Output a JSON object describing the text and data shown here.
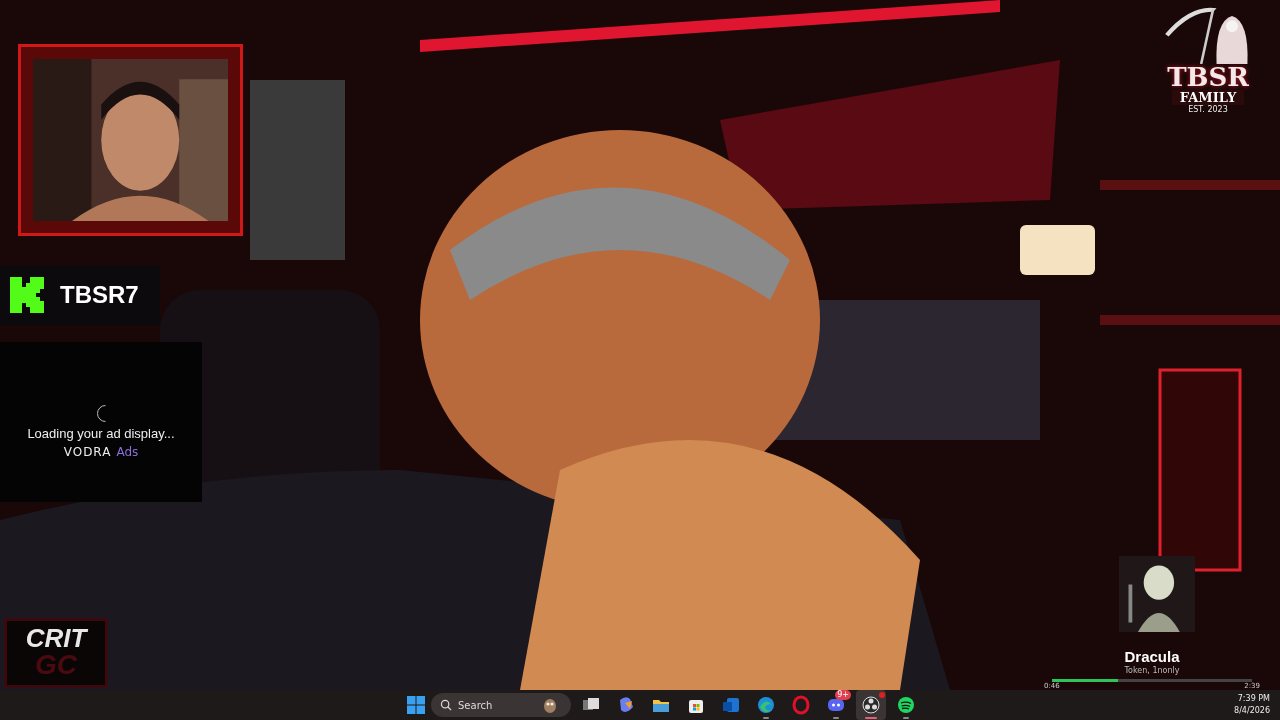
{
  "overlays": {
    "channel": {
      "name": "TBSR7"
    },
    "ad_panel": {
      "message": "Loading your ad display...",
      "brand": "VODRA",
      "brand_suffix": "Ads"
    },
    "corner_logo": {
      "line_1": "CRIT",
      "line_2": "GC"
    },
    "family_logo": {
      "title": "TBSR",
      "subtitle": "FAMILY",
      "established": "EST. 2023"
    },
    "now_playing": {
      "title": "Dracula",
      "artist": "Token, 1nonly",
      "level": 0.33,
      "elapsed": "0:46",
      "duration": "2:39"
    }
  },
  "taskbar": {
    "search": {
      "placeholder": "Search"
    },
    "apps": [
      {
        "kind": "taskview",
        "running": false,
        "selected": false
      },
      {
        "kind": "copilot",
        "running": false,
        "selected": false
      },
      {
        "kind": "folder",
        "running": false,
        "selected": false
      },
      {
        "kind": "store",
        "running": false,
        "selected": false
      },
      {
        "kind": "mail",
        "running": false,
        "selected": false
      },
      {
        "kind": "edge",
        "running": true,
        "selected": false
      },
      {
        "kind": "opera",
        "running": false,
        "selected": false
      },
      {
        "kind": "discord",
        "running": true,
        "selected": false,
        "badge": "9+"
      },
      {
        "kind": "obs",
        "running": true,
        "selected": true
      },
      {
        "kind": "spotify",
        "running": true,
        "selected": false
      }
    ],
    "clock": {
      "time": "7:39 PM",
      "date": "8/4/2026"
    }
  }
}
